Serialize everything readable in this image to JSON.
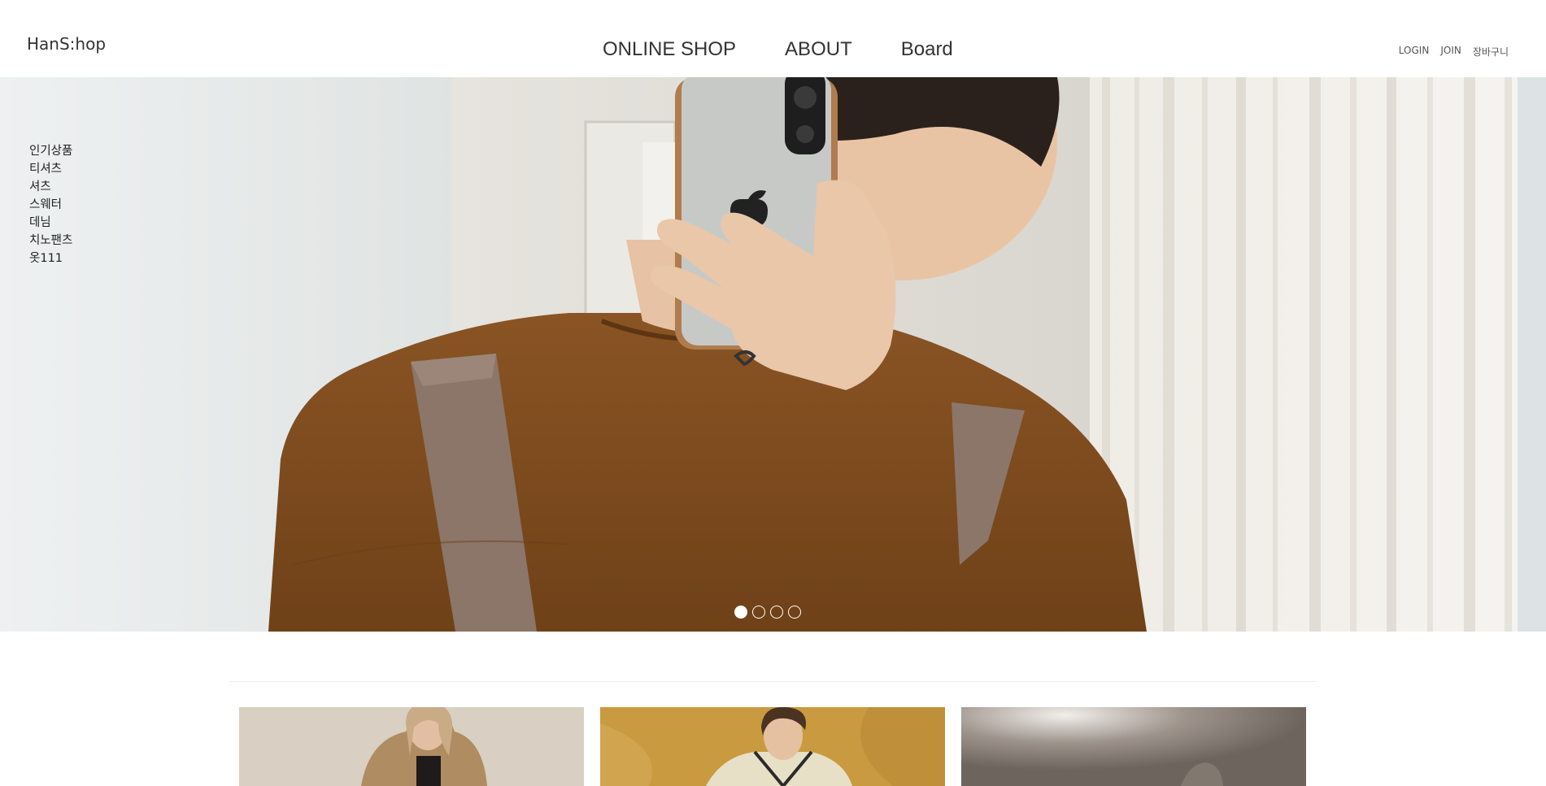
{
  "header": {
    "logo": "HanS:hop",
    "nav": [
      {
        "label": "ONLINE SHOP"
      },
      {
        "label": "ABOUT"
      },
      {
        "label": "Board"
      }
    ],
    "util": [
      {
        "label": "LOGIN"
      },
      {
        "label": "JOIN"
      },
      {
        "label": "장바구니"
      }
    ]
  },
  "categories": [
    "인기상품",
    "티셔츠",
    "셔츠",
    "스웨터",
    "데님",
    "치노팬츠",
    "옷111"
  ],
  "slider": {
    "slide_count": 4,
    "active_index": 0
  },
  "products": [
    {
      "image": "model-beige-jacket"
    },
    {
      "image": "model-cream-cardigan"
    },
    {
      "image": "dim-room-photo"
    }
  ],
  "colors": {
    "shirt_brown": "#7a4a1e",
    "text_dark": "#333333"
  }
}
